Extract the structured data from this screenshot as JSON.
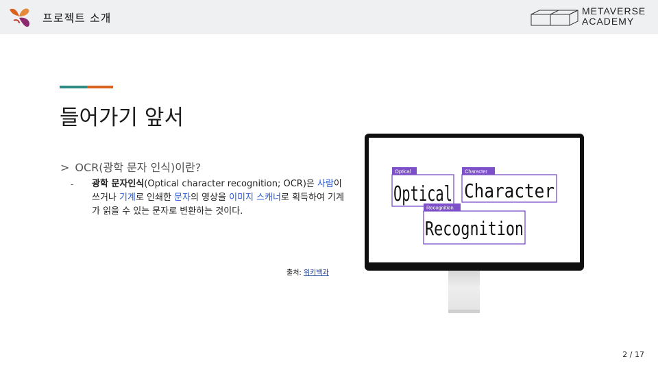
{
  "header": {
    "section_title": "프로젝트 소개",
    "brand_line1": "METAVERSE",
    "brand_line2": "ACADEMY",
    "logo_icon": "butterfly-logo-icon",
    "brand_icon": "academy-cube-icon"
  },
  "colors": {
    "accent_teal": "#2e8b84",
    "accent_orange": "#d9621f",
    "ocr_box": "#7d4fc9",
    "link_blue": "#2a5bd7"
  },
  "slide": {
    "title": "들어가기 앞서",
    "question_marker": ">",
    "question": "OCR(광학 문자 인식)이란?",
    "bullet_marker": "-",
    "definition": {
      "term": "광학 문자인식",
      "part1": "(Optical character recognition; OCR)은 ",
      "link1": "사람",
      "part2": "이 쓰거나 ",
      "link2": "기계",
      "part3": "로 인쇄한 ",
      "link3": "문자",
      "part4": "의 영상을 ",
      "link4": "이미지 스캐너",
      "part5": "로 획득하여 기계가 읽을 수 있는 문자로 변환하는 것이다."
    },
    "source_label": "출처: ",
    "source_link": "위키백과"
  },
  "ocr_image": {
    "labels": [
      "Optical",
      "Character",
      "Recognition"
    ],
    "words": [
      "Optical",
      "Character",
      "Recognition"
    ]
  },
  "page": {
    "number": "2 / 17"
  }
}
